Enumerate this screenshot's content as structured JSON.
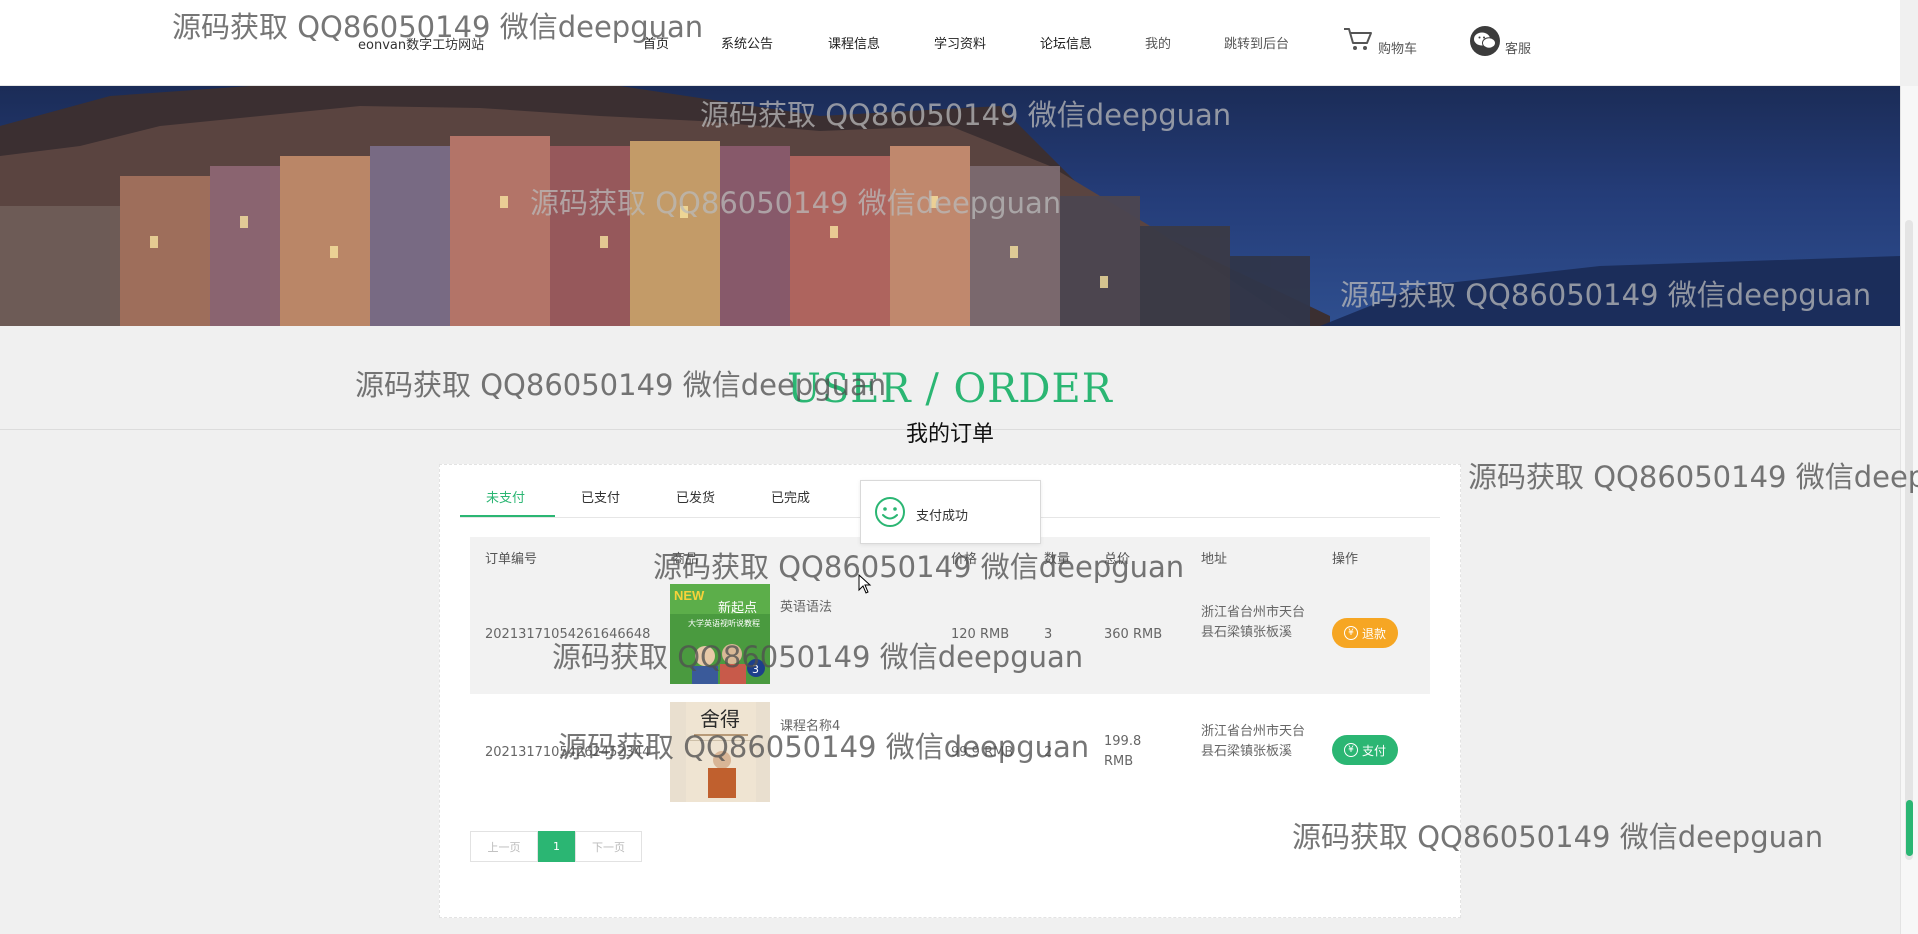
{
  "header": {
    "site_name": "eonvan数字工坊网站",
    "nav": [
      {
        "label": "首页"
      },
      {
        "label": "系统公告"
      },
      {
        "label": "课程信息"
      },
      {
        "label": "学习资料"
      },
      {
        "label": "论坛信息"
      },
      {
        "label": "我的"
      },
      {
        "label": "跳转到后台"
      },
      {
        "label": "购物车"
      },
      {
        "label": "客服"
      }
    ]
  },
  "section": {
    "title_en": "USER / ORDER",
    "title_cn": "我的订单"
  },
  "tabs": [
    {
      "label": "未支付",
      "active": true
    },
    {
      "label": "已支付"
    },
    {
      "label": "已发货"
    },
    {
      "label": "已完成"
    }
  ],
  "toast": {
    "message": "支付成功",
    "icon": "smile-icon"
  },
  "table": {
    "headers": [
      "订单编号",
      "商品",
      "价格",
      "数量",
      "总价",
      "地址",
      "操作"
    ],
    "rows": [
      {
        "order_id": "20213171054261646648",
        "product": "英语语法",
        "price": "120 RMB",
        "qty": "3",
        "total": "360 RMB",
        "address": "浙江省台州市天台县石梁镇张板溪",
        "action": "退款",
        "thumb_title": "新起点",
        "thumb_badge": "NEW",
        "thumb_sub": "大学英语视听说教程",
        "thumb_num": "3"
      },
      {
        "order_id": "20213171054262452344",
        "product": "课程名称4",
        "price": "99.9 RMB",
        "qty": "2",
        "total": "199.8 RMB",
        "address": "浙江省台州市天台县石梁镇张板溪",
        "action": "支付",
        "thumb_title": "舍得"
      }
    ]
  },
  "pagination": {
    "prev": "上一页",
    "current": "1",
    "next": "下一页"
  },
  "watermark": "源码获取 QQ86050149 微信deepguan",
  "colors": {
    "accent": "#2bb673",
    "refund": "#f6a623"
  }
}
